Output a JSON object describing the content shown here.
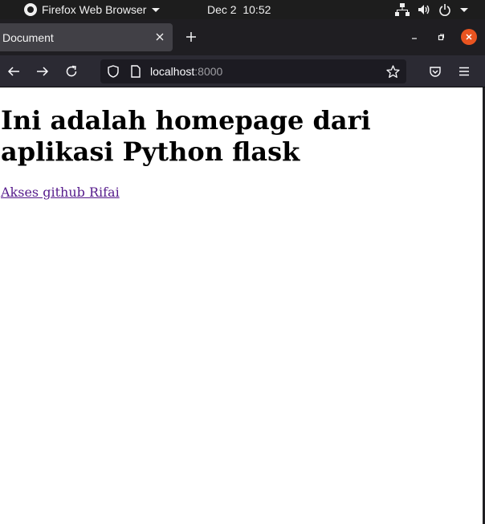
{
  "system_bar": {
    "app_name": "Firefox Web Browser",
    "clock": "Dec 2  10:52",
    "tray_icons": [
      "network-icon",
      "volume-icon",
      "power-icon",
      "chevron-down-icon"
    ]
  },
  "browser": {
    "tab": {
      "title": "Document"
    },
    "url": {
      "host": "localhost",
      "port": ":8000"
    },
    "nav_icons": [
      "arrow-left-icon",
      "arrow-right-icon",
      "reload-icon"
    ],
    "toolbar_icons": [
      "pocket-icon",
      "hamburger-menu-icon"
    ],
    "colors": {
      "close_button": "#e95420",
      "tab_active": "#414046",
      "toolbar": "#2b2a33",
      "visited_link": "#551a8b"
    }
  },
  "page": {
    "heading": "Ini adalah homepage dari aplikasi Python flask",
    "link_text": "Akses github Rifai"
  }
}
